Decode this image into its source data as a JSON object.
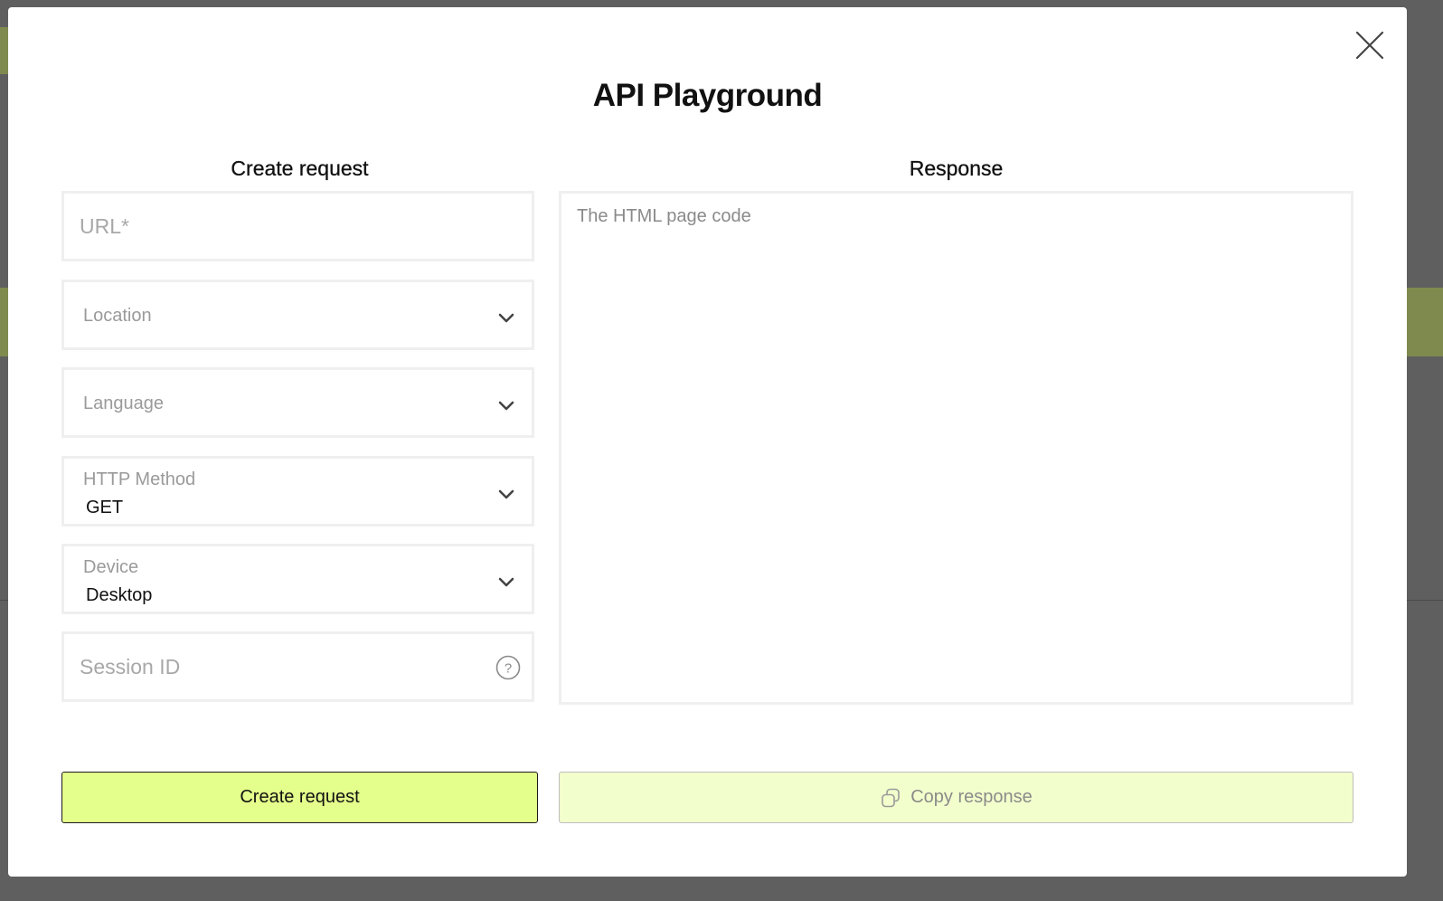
{
  "modal": {
    "title": "API Playground",
    "close_icon": "close-icon"
  },
  "request": {
    "heading": "Create request",
    "url": {
      "placeholder": "URL*",
      "value": ""
    },
    "location": {
      "placeholder": "Location",
      "value": ""
    },
    "language": {
      "placeholder": "Language",
      "value": ""
    },
    "http_method": {
      "label": "HTTP Method",
      "value": "GET"
    },
    "device": {
      "label": "Device",
      "value": "Desktop"
    },
    "session_id": {
      "placeholder": "Session ID",
      "value": "",
      "help_icon": "question-circle-icon"
    },
    "submit_label": "Create request"
  },
  "response": {
    "heading": "Response",
    "placeholder": "The HTML page code",
    "value": "",
    "copy_label": "Copy response",
    "copy_icon": "copy-icon"
  },
  "colors": {
    "primary_button": "#e5ff8c",
    "disabled_button": "#f2ffcc",
    "field_border": "#efefef"
  }
}
